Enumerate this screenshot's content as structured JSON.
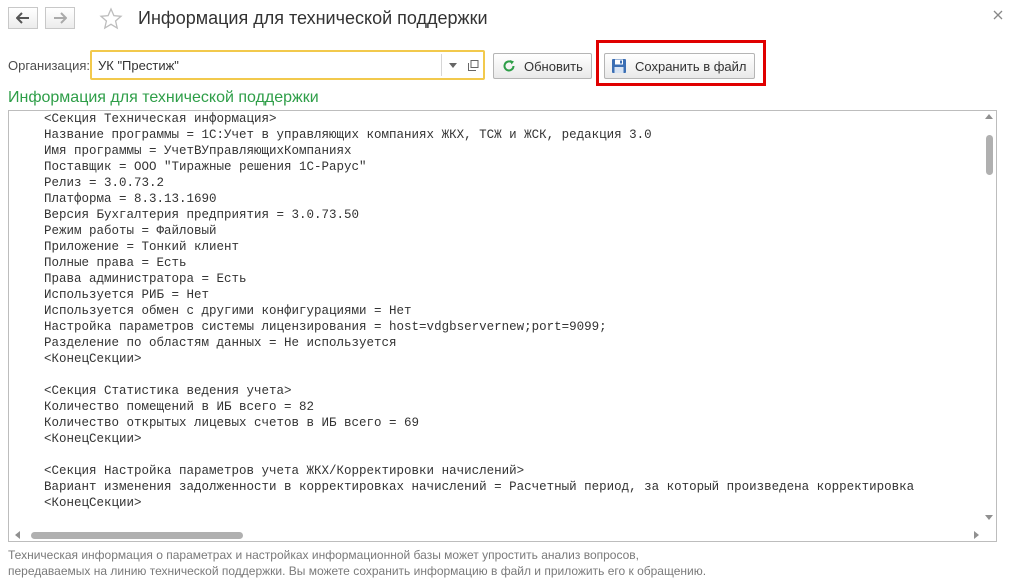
{
  "header": {
    "title": "Информация для технической поддержки",
    "back_icon": "arrow-left-icon",
    "forward_icon": "arrow-right-icon",
    "favorite_icon": "star-icon",
    "close_icon": "close-icon"
  },
  "toolbar": {
    "org_label": "Организация:",
    "org_value": "УК \"Престиж\"",
    "refresh_label": "Обновить",
    "save_label": "Сохранить в файл"
  },
  "section": {
    "title": "Информация для технической поддержки"
  },
  "content": {
    "text": "<Секция Техническая информация>\nНазвание программы = 1С:Учет в управляющих компаниях ЖКХ, ТСЖ и ЖСК, редакция 3.0\nИмя программы = УчетВУправляющихКомпаниях\nПоставщик = ООО \"Тиражные решения 1С-Рарус\"\nРелиз = 3.0.73.2\nПлатформа = 8.3.13.1690\nВерсия Бухгалтерия предприятия = 3.0.73.50\nРежим работы = Файловый\nПриложение = Тонкий клиент\nПолные права = Есть\nПрава администратора = Есть\nИспользуется РИБ = Нет\nИспользуется обмен с другими конфигурациями = Нет\nНастройка параметров системы лицензирования = host=vdgbservernew;port=9099;\nРазделение по областям данных = Не используется\n<КонецСекции>\n\n<Секция Статистика ведения учета>\nКоличество помещений в ИБ всего = 82\nКоличество открытых лицевых счетов в ИБ всего = 69\n<КонецСекции>\n\n<Секция Настройка параметров учета ЖКХ/Корректировки начислений>\nВариант изменения задолженности в корректировках начислений = Расчетный период, за который произведена корректировка\n<КонецСекции>"
  },
  "footer": {
    "line1": "Техническая информация о параметрах и настройках информационной базы может упростить анализ вопросов,",
    "line2": "передаваемых на линию технической поддержки. Вы можете сохранить информацию в файл и приложить его к обращению."
  },
  "colors": {
    "section_title": "#2e9e48",
    "highlight_frame": "#e00000",
    "focus_border": "#f2c94c",
    "footer_text": "#7a7a7a"
  }
}
